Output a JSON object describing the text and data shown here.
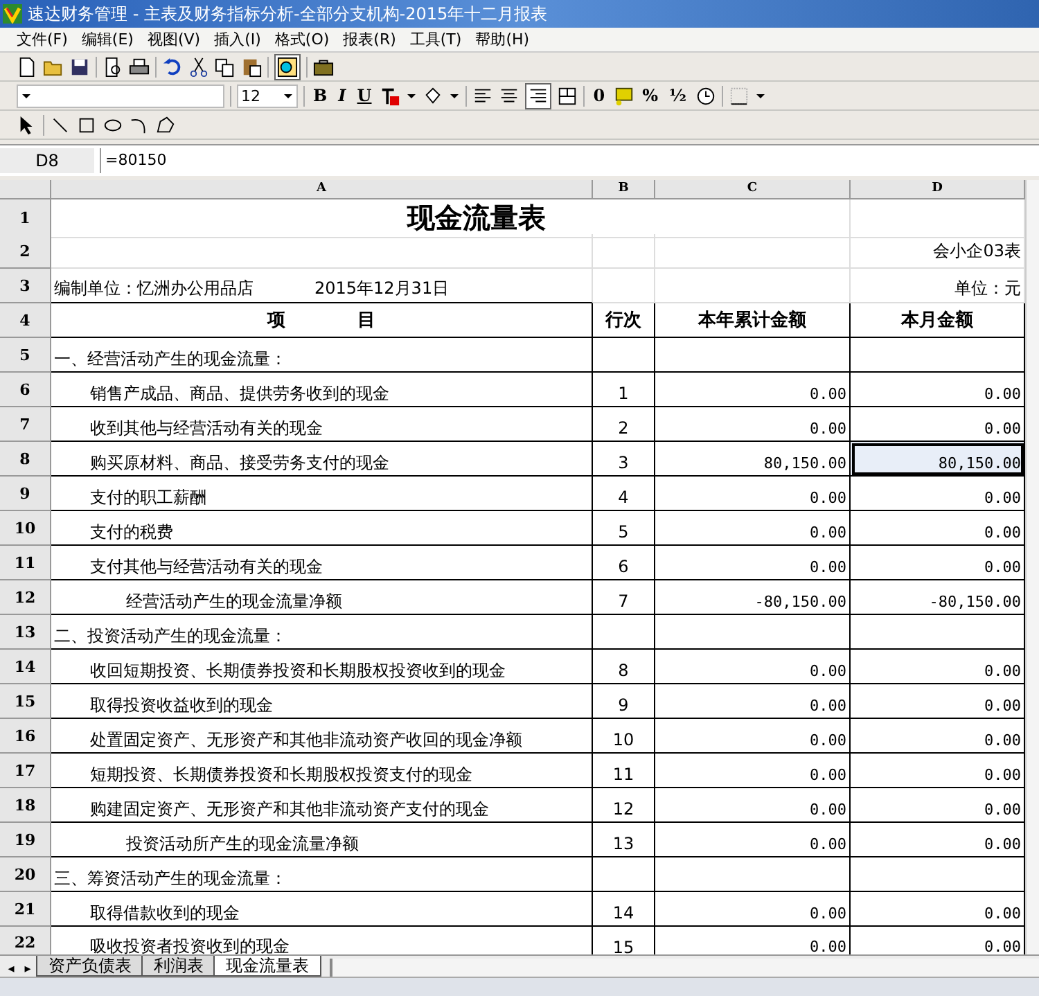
{
  "window": {
    "title": "速达财务管理 - 主表及财务指标分析-全部分支机构-2015年十二月报表"
  },
  "menu": [
    "文件(F)",
    "编辑(E)",
    "视图(V)",
    "插入(I)",
    "格式(O)",
    "报表(R)",
    "工具(T)",
    "帮助(H)"
  ],
  "format_bar": {
    "size": "12",
    "style_buttons": [
      "B",
      "I",
      "U"
    ],
    "number_buttons": [
      "0",
      "%",
      "½"
    ]
  },
  "formula_bar": {
    "cell_ref": "D8",
    "formula": "=80150"
  },
  "column_headers": [
    "A",
    "B",
    "C",
    "D"
  ],
  "header_row_numbers": [
    "1",
    "2",
    "3",
    "4"
  ],
  "sheet_nav": [
    "◂",
    "▸"
  ],
  "report": {
    "title": "现金流量表",
    "form_code": "会小企03表",
    "compiler": "编制单位：忆洲办公用品店",
    "date": "2015年12月31日",
    "unit": "单位：元"
  },
  "table": {
    "columns": [
      "项　　　　目",
      "行次",
      "本年累计金额",
      "本月金额"
    ],
    "rows": [
      {
        "row_number": "5",
        "kind": "section",
        "item": "一、经营活动产生的现金流量：",
        "line": "",
        "ytd": "",
        "month": "",
        "selected": false
      },
      {
        "row_number": "6",
        "kind": "item",
        "item": "销售产成品、商品、提供劳务收到的现金",
        "line": "1",
        "ytd": "0.00",
        "month": "0.00",
        "selected": false
      },
      {
        "row_number": "7",
        "kind": "item",
        "item": "收到其他与经营活动有关的现金",
        "line": "2",
        "ytd": "0.00",
        "month": "0.00",
        "selected": false
      },
      {
        "row_number": "8",
        "kind": "item",
        "item": "购买原材料、商品、接受劳务支付的现金",
        "line": "3",
        "ytd": "80,150.00",
        "month": "80,150.00",
        "selected": true
      },
      {
        "row_number": "9",
        "kind": "item",
        "item": "支付的职工薪酬",
        "line": "4",
        "ytd": "0.00",
        "month": "0.00",
        "selected": false
      },
      {
        "row_number": "10",
        "kind": "item",
        "item": "支付的税费",
        "line": "5",
        "ytd": "0.00",
        "month": "0.00",
        "selected": false
      },
      {
        "row_number": "11",
        "kind": "item",
        "item": "支付其他与经营活动有关的现金",
        "line": "6",
        "ytd": "0.00",
        "month": "0.00",
        "selected": false
      },
      {
        "row_number": "12",
        "kind": "total",
        "item": "经营活动产生的现金流量净额",
        "line": "7",
        "ytd": "-80,150.00",
        "month": "-80,150.00",
        "selected": false
      },
      {
        "row_number": "13",
        "kind": "section",
        "item": "二、投资活动产生的现金流量：",
        "line": "",
        "ytd": "",
        "month": "",
        "selected": false
      },
      {
        "row_number": "14",
        "kind": "item",
        "item": "收回短期投资、长期债券投资和长期股权投资收到的现金",
        "line": "8",
        "ytd": "0.00",
        "month": "0.00",
        "selected": false
      },
      {
        "row_number": "15",
        "kind": "item",
        "item": "取得投资收益收到的现金",
        "line": "9",
        "ytd": "0.00",
        "month": "0.00",
        "selected": false
      },
      {
        "row_number": "16",
        "kind": "item",
        "item": "处置固定资产、无形资产和其他非流动资产收回的现金净额",
        "line": "10",
        "ytd": "0.00",
        "month": "0.00",
        "selected": false
      },
      {
        "row_number": "17",
        "kind": "item",
        "item": "短期投资、长期债券投资和长期股权投资支付的现金",
        "line": "11",
        "ytd": "0.00",
        "month": "0.00",
        "selected": false
      },
      {
        "row_number": "18",
        "kind": "item",
        "item": "购建固定资产、无形资产和其他非流动资产支付的现金",
        "line": "12",
        "ytd": "0.00",
        "month": "0.00",
        "selected": false
      },
      {
        "row_number": "19",
        "kind": "total",
        "item": "投资活动所产生的现金流量净额",
        "line": "13",
        "ytd": "0.00",
        "month": "0.00",
        "selected": false
      },
      {
        "row_number": "20",
        "kind": "section",
        "item": "三、筹资活动产生的现金流量：",
        "line": "",
        "ytd": "",
        "month": "",
        "selected": false
      },
      {
        "row_number": "21",
        "kind": "item",
        "item": "取得借款收到的现金",
        "line": "14",
        "ytd": "0.00",
        "month": "0.00",
        "selected": false
      },
      {
        "row_number": "22",
        "kind": "item",
        "item": "吸收投资者投资收到的现金",
        "line": "15",
        "ytd": "0.00",
        "month": "0.00",
        "selected": false
      }
    ]
  },
  "sheet_tabs": [
    {
      "label": "资产负债表",
      "selected": false
    },
    {
      "label": "利润表",
      "selected": false
    },
    {
      "label": "现金流量表",
      "selected": true
    }
  ]
}
